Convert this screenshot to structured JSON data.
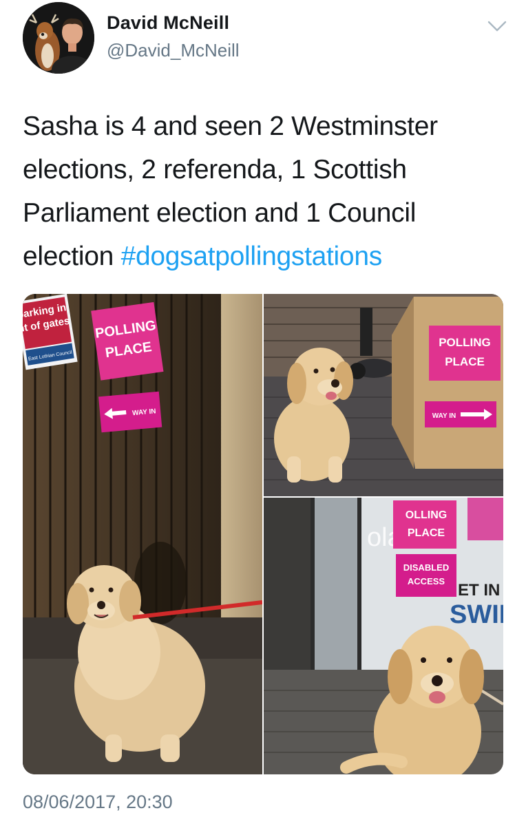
{
  "author": {
    "name": "David McNeill",
    "handle": "@David_McNeill",
    "avatar_icon": "profile-photo"
  },
  "menu": {
    "icon": "chevron-down-icon"
  },
  "tweet": {
    "text_lines": [
      "Sasha is 4 and seen 2 Westminster",
      "elections, 2 referenda, 1 Scottish",
      "Parliament election and 1 Council",
      "election "
    ],
    "hashtag": "#dogsatpollingstations",
    "timestamp": "08/06/2017, 20:30"
  },
  "photos": {
    "photo1": {
      "parking_sign_line1": "parking in",
      "parking_sign_line2": "nt of gates",
      "parking_sign_footer": "East Lothian Council",
      "polling_line1": "POLLING",
      "polling_line2": "PLACE",
      "way_in": "WAY IN"
    },
    "photo2": {
      "polling_line1": "POLLING",
      "polling_line2": "PLACE",
      "way_in": "WAY IN"
    },
    "photo3": {
      "polling_line1": "OLLING",
      "polling_line2": "PLACE",
      "disabled_line1": "DISABLED",
      "disabled_line2": "ACCESS",
      "window_text1": "olas",
      "window_text2": "ET IN T",
      "window_text3": "SWIN"
    }
  },
  "colors": {
    "hashtag": "#1da1f2",
    "handle": "#657786",
    "sign_pink": "#e0338f",
    "sign_magenta": "#d41d8c"
  }
}
